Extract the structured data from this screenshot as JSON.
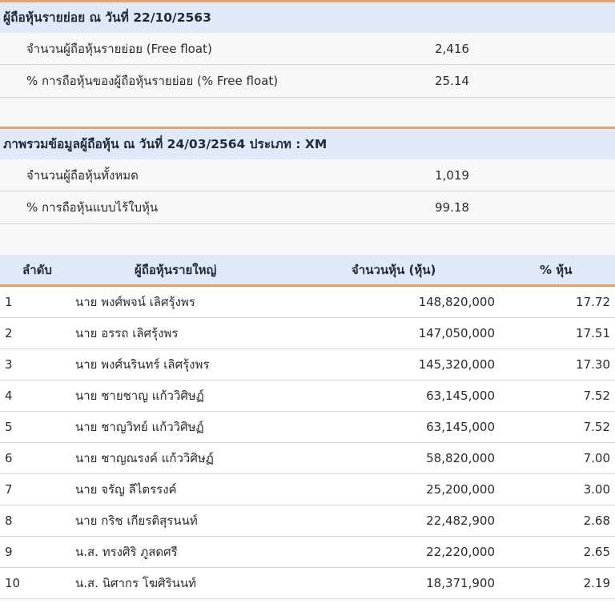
{
  "free_float": {
    "title": "ผู้ถือหุ้นรายย่อย ณ วันที่ 22/10/2563",
    "rows": [
      {
        "label": "จำนวนผู้ถือหุ้นรายย่อย (Free float)",
        "value": "2,416"
      },
      {
        "label": "% การถือหุ้นของผู้ถือหุ้นรายย่อย (% Free float)",
        "value": "25.14"
      }
    ]
  },
  "overview": {
    "title": "ภาพรวมข้อมูลผู้ถือหุ้น ณ วันที่ 24/03/2564 ประเภท : XM",
    "rows": [
      {
        "label": "จำนวนผู้ถือหุ้นทั้งหมด",
        "value": "1,019"
      },
      {
        "label": "% การถือหุ้นแบบไร้ใบหุ้น",
        "value": "99.18"
      }
    ]
  },
  "major_holders": {
    "headers": {
      "rank": "ลำดับ",
      "name": "ผู้ถือหุ้นรายใหญ่",
      "shares": "จำนวนหุ้น (หุ้น)",
      "pct": "% หุ้น"
    },
    "rows": [
      {
        "rank": "1",
        "name": "นาย พงศ์พจน์ เลิศรุ้งพร",
        "shares": "148,820,000",
        "pct": "17.72"
      },
      {
        "rank": "2",
        "name": "นาย อรรถ เลิศรุ้งพร",
        "shares": "147,050,000",
        "pct": "17.51"
      },
      {
        "rank": "3",
        "name": "นาย พงศ์นรินทร์ เลิศรุ้งพร",
        "shares": "145,320,000",
        "pct": "17.30"
      },
      {
        "rank": "4",
        "name": "นาย ชายชาญ แก้ววิศิษฏ์",
        "shares": "63,145,000",
        "pct": "7.52"
      },
      {
        "rank": "5",
        "name": "นาย ชาญวิทย์ แก้ววิศิษฏ์",
        "shares": "63,145,000",
        "pct": "7.52"
      },
      {
        "rank": "6",
        "name": "นาย ชาญณรงค์ แก้ววิศิษฏ์",
        "shares": "58,820,000",
        "pct": "7.00"
      },
      {
        "rank": "7",
        "name": "นาย จรัญ ลีไตรรงค์",
        "shares": "25,200,000",
        "pct": "3.00"
      },
      {
        "rank": "8",
        "name": "นาย กริช เกียรติสุรนนท์",
        "shares": "22,482,900",
        "pct": "2.68"
      },
      {
        "rank": "9",
        "name": "น.ส. ทรงศิริ ภูสดศรี",
        "shares": "22,220,000",
        "pct": "2.65"
      },
      {
        "rank": "10",
        "name": "น.ส. นิศากร โฆศิรินนท์",
        "shares": "18,371,900",
        "pct": "2.19"
      }
    ]
  }
}
